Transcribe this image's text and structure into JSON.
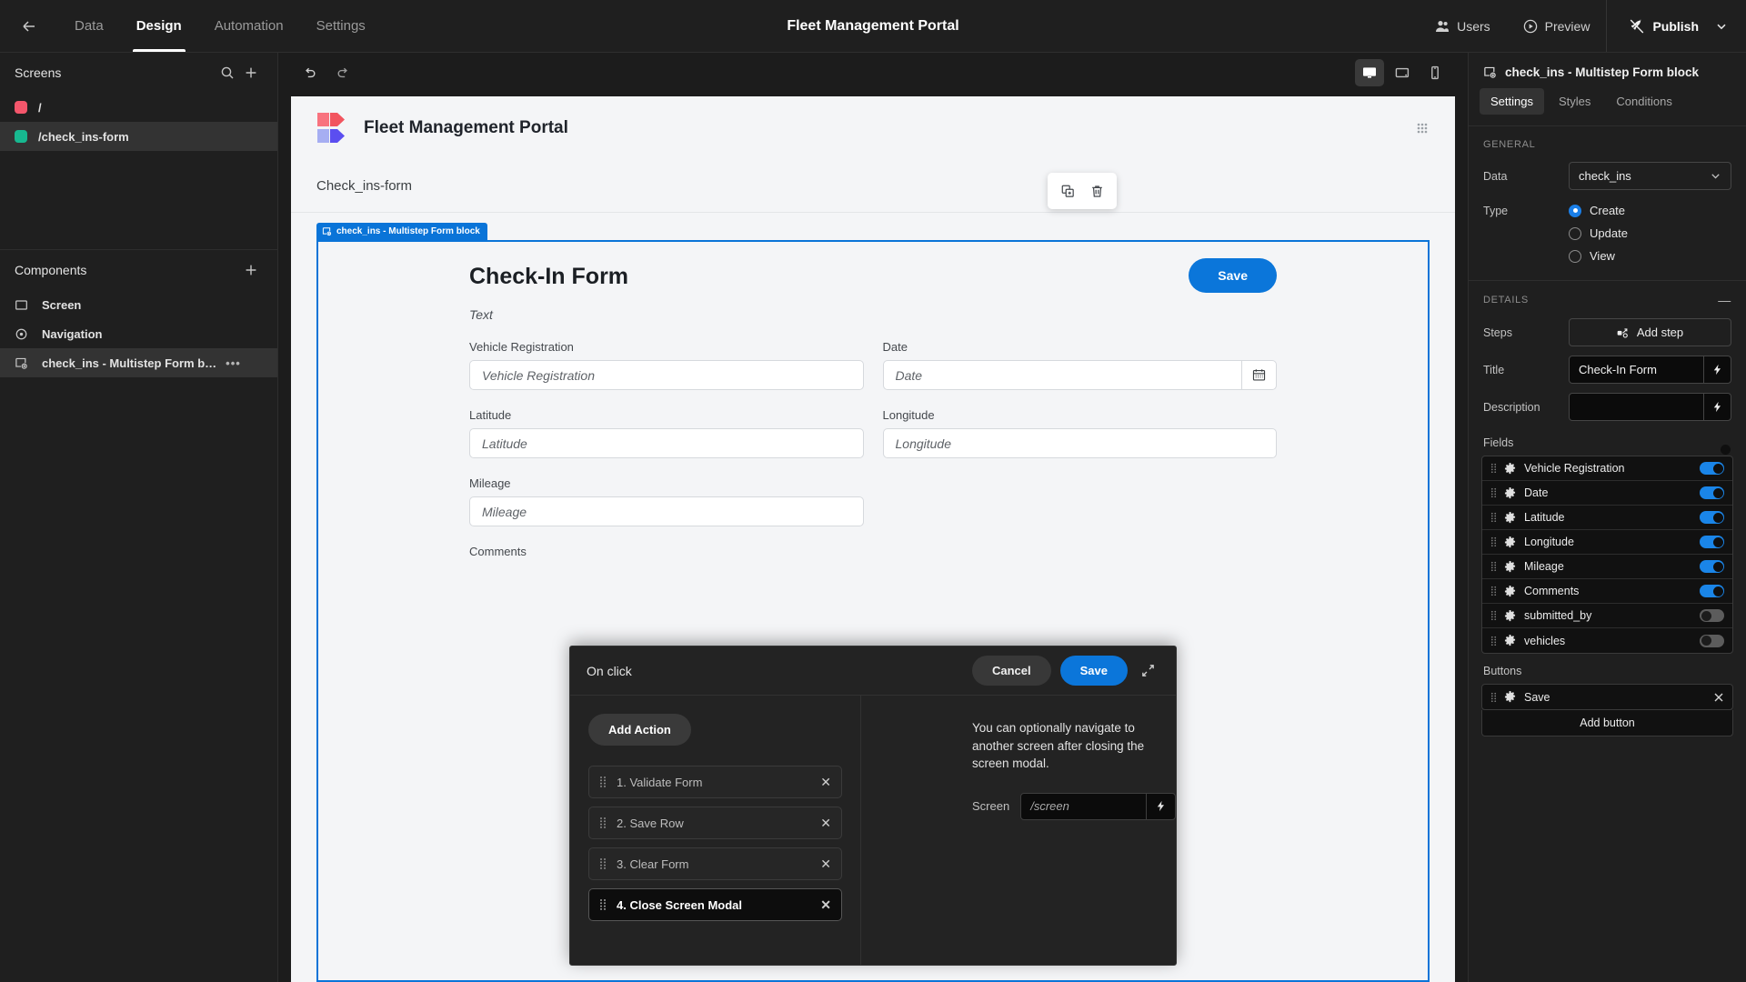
{
  "topbar": {
    "back_icon": "arrow-left-icon",
    "tabs": [
      {
        "label": "Data",
        "active": false
      },
      {
        "label": "Design",
        "active": true
      },
      {
        "label": "Automation",
        "active": false
      },
      {
        "label": "Settings",
        "active": false
      }
    ],
    "app_title": "Fleet Management Portal",
    "users_label": "Users",
    "preview_label": "Preview",
    "publish_label": "Publish"
  },
  "left_panel": {
    "screens_title": "Screens",
    "screens": [
      {
        "label": "/",
        "color": "#f4566b",
        "selected": false
      },
      {
        "label": "/check_ins-form",
        "color": "#17b890",
        "selected": true
      }
    ],
    "components_title": "Components",
    "components": [
      {
        "label": "Screen",
        "icon": "screen-icon",
        "selected": false,
        "menu": false
      },
      {
        "label": "Navigation",
        "icon": "navigation-icon",
        "selected": false,
        "menu": false
      },
      {
        "label": "check_ins - Multistep Form b…",
        "icon": "form-block-icon",
        "selected": true,
        "menu": true
      }
    ]
  },
  "canvas": {
    "undo_icon": "undo-icon",
    "redo_icon": "redo-icon",
    "devices": [
      {
        "name": "desktop-icon",
        "active": true
      },
      {
        "name": "tablet-icon",
        "active": false
      },
      {
        "name": "mobile-icon",
        "active": false
      }
    ],
    "preview": {
      "brand_title": "Fleet Management Portal",
      "section_label": "Check_ins-form",
      "block_tag": "check_ins - Multistep Form block",
      "form": {
        "title": "Check-In Form",
        "save_label": "Save",
        "description": "Text",
        "rows": [
          [
            {
              "label": "Vehicle Registration",
              "placeholder": "Vehicle Registration",
              "type": "text"
            },
            {
              "label": "Date",
              "placeholder": "Date",
              "type": "date"
            }
          ],
          [
            {
              "label": "Latitude",
              "placeholder": "Latitude",
              "type": "text"
            },
            {
              "label": "Longitude",
              "placeholder": "Longitude",
              "type": "text"
            }
          ],
          [
            {
              "label": "Mileage",
              "placeholder": "Mileage",
              "type": "text"
            },
            {
              "label": "",
              "placeholder": "",
              "type": "empty"
            }
          ]
        ],
        "trailing_label": "Comments"
      }
    }
  },
  "drawer": {
    "title": "On click",
    "cancel_label": "Cancel",
    "save_label": "Save",
    "expand_icon": "expand-icon",
    "add_action_label": "Add Action",
    "actions": [
      {
        "label": "1. Validate Form",
        "selected": false
      },
      {
        "label": "2. Save Row",
        "selected": false
      },
      {
        "label": "3. Clear Form",
        "selected": false
      },
      {
        "label": "4. Close Screen Modal",
        "selected": true
      }
    ],
    "note": "You can optionally navigate to another screen after closing the screen modal.",
    "screen_label": "Screen",
    "screen_placeholder": "/screen",
    "screen_value": ""
  },
  "right_panel": {
    "header_title": "check_ins - Multistep Form block",
    "tabs": [
      {
        "label": "Settings",
        "active": true
      },
      {
        "label": "Styles",
        "active": false
      },
      {
        "label": "Conditions",
        "active": false
      }
    ],
    "general_label": "GENERAL",
    "data_label": "Data",
    "data_value": "check_ins",
    "type_label": "Type",
    "type_options": [
      {
        "label": "Create",
        "selected": true
      },
      {
        "label": "Update",
        "selected": false
      },
      {
        "label": "View",
        "selected": false
      }
    ],
    "details_label": "DETAILS",
    "steps_label": "Steps",
    "add_step_label": "Add step",
    "title_label": "Title",
    "title_value": "Check-In Form",
    "description_label": "Description",
    "description_value": "",
    "fields_label": "Fields",
    "fields_master_on": true,
    "fields": [
      {
        "label": "Vehicle Registration",
        "on": true
      },
      {
        "label": "Date",
        "on": true
      },
      {
        "label": "Latitude",
        "on": true
      },
      {
        "label": "Longitude",
        "on": true
      },
      {
        "label": "Mileage",
        "on": true
      },
      {
        "label": "Comments",
        "on": true
      },
      {
        "label": "submitted_by",
        "on": false
      },
      {
        "label": "vehicles",
        "on": false
      }
    ],
    "buttons_label": "Buttons",
    "buttons": [
      {
        "label": "Save"
      }
    ],
    "add_button_label": "Add button"
  },
  "colors": {
    "accent_blue": "#0b76da",
    "toggle_on": "#1a85e8",
    "selected_screen": "#17b890",
    "root_screen": "#f4566b"
  }
}
